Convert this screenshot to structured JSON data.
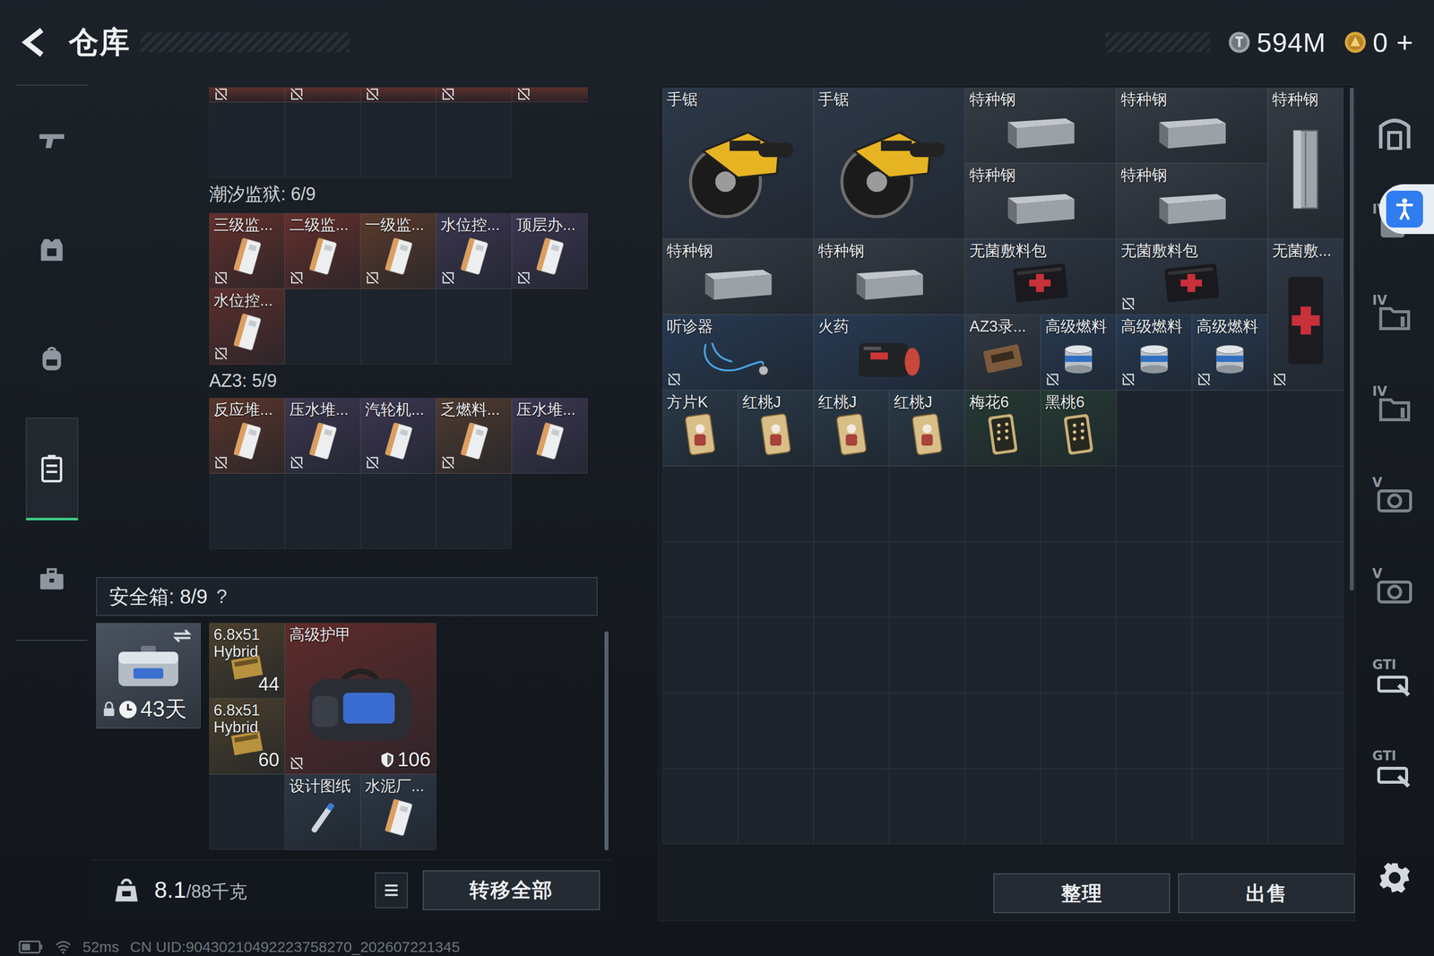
{
  "header": {
    "title": "仓库",
    "currencies": [
      {
        "kind": "silver",
        "amount": "594M"
      },
      {
        "kind": "gold",
        "amount": "0",
        "add": "+"
      }
    ]
  },
  "leftRail": [
    {
      "kind": "weapon",
      "selected": false
    },
    {
      "kind": "vest",
      "selected": false
    },
    {
      "kind": "backpack",
      "selected": false
    },
    {
      "kind": "storage",
      "selected": true
    },
    {
      "kind": "briefcase",
      "selected": false
    }
  ],
  "clippedContainer": {
    "items": [
      {
        "marked": true,
        "color": "#5a2f2c"
      },
      {
        "marked": true,
        "color": "#5a2f2c"
      },
      {
        "marked": true,
        "color": "#5a2f2c"
      },
      {
        "marked": true,
        "color": "#5a2f2c"
      },
      {
        "marked": true,
        "color": "#5a2f2c"
      }
    ],
    "emptySlots": 4
  },
  "containers": [
    {
      "title": "潮汐监狱: 6/9",
      "emptySlots": 3,
      "items": [
        {
          "label": "三级监...",
          "kind": "keycard",
          "marked": true,
          "color": "#63302c"
        },
        {
          "label": "二级监...",
          "kind": "keycard",
          "marked": true,
          "color": "#63302c"
        },
        {
          "label": "一级监...",
          "kind": "keycard",
          "marked": true,
          "color": "#5a3a2c"
        },
        {
          "label": "水位控...",
          "kind": "keycard",
          "marked": true,
          "color": "#3c3650"
        },
        {
          "label": "顶层办...",
          "kind": "keycard",
          "marked": true,
          "color": "#3c3650"
        },
        {
          "label": "水位控...",
          "kind": "keycard",
          "marked": true,
          "color": "#5a2f2c"
        }
      ]
    },
    {
      "title": "AZ3: 5/9",
      "emptySlots": 4,
      "items": [
        {
          "label": "反应堆...",
          "kind": "keycard",
          "marked": true,
          "color": "#5a352a"
        },
        {
          "label": "压水堆...",
          "kind": "keycard",
          "marked": true,
          "color": "#3c3650"
        },
        {
          "label": "汽轮机...",
          "kind": "keycard",
          "marked": true,
          "color": "#3c3650"
        },
        {
          "label": "乏燃料...",
          "kind": "keycard",
          "marked": true,
          "color": "#4e3a30"
        },
        {
          "label": "压水堆...",
          "kind": "keycard",
          "marked": false,
          "color": "#3c3650"
        }
      ]
    }
  ],
  "safeBox": {
    "title": "安全箱: 8/9",
    "help": "?",
    "case": {
      "days": "43天",
      "locked": true
    },
    "items": [
      {
        "label": "6.8x51",
        "sub": "Hybrid",
        "count": "44",
        "kind": "ammo",
        "marked": false,
        "color": "#4a3f2c"
      },
      {
        "label": "高级护甲",
        "kind": "armor",
        "marked": true,
        "durability": "106",
        "color": "#5e2b2b"
      },
      {
        "label": "6.8x51",
        "sub": "Hybrid",
        "count": "60",
        "kind": "ammo",
        "marked": false,
        "color": "#4a3f2c"
      },
      {
        "kind": "empty"
      },
      {
        "label": "设计图纸",
        "kind": "blueprint",
        "marked": false,
        "color": "#2d3846"
      },
      {
        "label": "水泥厂...",
        "kind": "keycard",
        "marked": false,
        "color": "#2d3846"
      }
    ]
  },
  "weight": {
    "value": "8.1",
    "capacity": "/88千克"
  },
  "transferAll": "转移全部",
  "storage": {
    "columns": 9,
    "rows": 10,
    "items": [
      {
        "label": "手锯",
        "kind": "saw",
        "marked": false,
        "color": "#2d3848"
      },
      {
        "label": "手锯",
        "kind": "saw",
        "marked": false,
        "color": "#2d3848"
      },
      {
        "label": "特种钢",
        "kind": "steel",
        "marked": false,
        "color": "#363c44"
      },
      {
        "label": "特种钢",
        "kind": "steel",
        "marked": false,
        "color": "#363c44"
      },
      {
        "label": "特种钢",
        "kind": "steel-v",
        "marked": false,
        "color": "#363c44"
      },
      {
        "label": "特种钢",
        "kind": "steel",
        "marked": false,
        "color": "#363c44"
      },
      {
        "label": "特种钢",
        "kind": "steel",
        "marked": false,
        "color": "#363c44"
      },
      {
        "label": "特种钢",
        "kind": "steel",
        "marked": false,
        "color": "#363c44"
      },
      {
        "label": "特种钢",
        "kind": "steel",
        "marked": false,
        "color": "#363c44"
      },
      {
        "label": "无菌敷料包",
        "kind": "medkit",
        "marked": false,
        "color": "#2e3845"
      },
      {
        "label": "无菌敷料包",
        "kind": "medkit",
        "marked": true,
        "color": "#2e3845"
      },
      {
        "label": "无菌敷...",
        "kind": "medkit-v",
        "marked": true,
        "color": "#2e3845"
      },
      {
        "label": "听诊器",
        "kind": "stethoscope",
        "marked": true,
        "color": "#283a52"
      },
      {
        "label": "火药",
        "kind": "gunpowder",
        "marked": false,
        "color": "#283a52"
      },
      {
        "label": "AZ3录...",
        "kind": "tape",
        "marked": false,
        "color": "#333a44"
      },
      {
        "label": "高级燃料",
        "kind": "fuel",
        "marked": true,
        "color": "#283a52"
      },
      {
        "label": "高级燃料",
        "kind": "fuel",
        "marked": true,
        "color": "#283a52"
      },
      {
        "label": "高级燃料",
        "kind": "fuel",
        "marked": true,
        "color": "#283a52"
      },
      {
        "label": "方片K",
        "kind": "card",
        "marked": false,
        "color": "#2a3a48"
      },
      {
        "label": "红桃J",
        "kind": "card",
        "marked": false,
        "color": "#2a3a48"
      },
      {
        "label": "红桃J",
        "kind": "card",
        "marked": false,
        "color": "#2a3a48"
      },
      {
        "label": "红桃J",
        "kind": "card",
        "marked": false,
        "color": "#2a3a48"
      },
      {
        "label": "梅花6",
        "kind": "pipcard",
        "marked": false,
        "color": "#263a33"
      },
      {
        "label": "黑桃6",
        "kind": "pipcard",
        "marked": false,
        "color": "#263a33"
      }
    ]
  },
  "actions": [
    "整理",
    "出售"
  ],
  "rightRail": [
    {
      "kind": "hideout"
    },
    {
      "kind": "slot-add",
      "label": "IV"
    },
    {
      "kind": "folder",
      "label": "IV"
    },
    {
      "kind": "folder",
      "label": "IV"
    },
    {
      "kind": "camera",
      "label": "V"
    },
    {
      "kind": "camera",
      "label": "V"
    },
    {
      "kind": "gti",
      "label": "GTI"
    },
    {
      "kind": "gti",
      "label": "GTI"
    }
  ],
  "status": {
    "ping": "52ms",
    "uid": "CN UID:90430210492223758270_202607221345"
  }
}
